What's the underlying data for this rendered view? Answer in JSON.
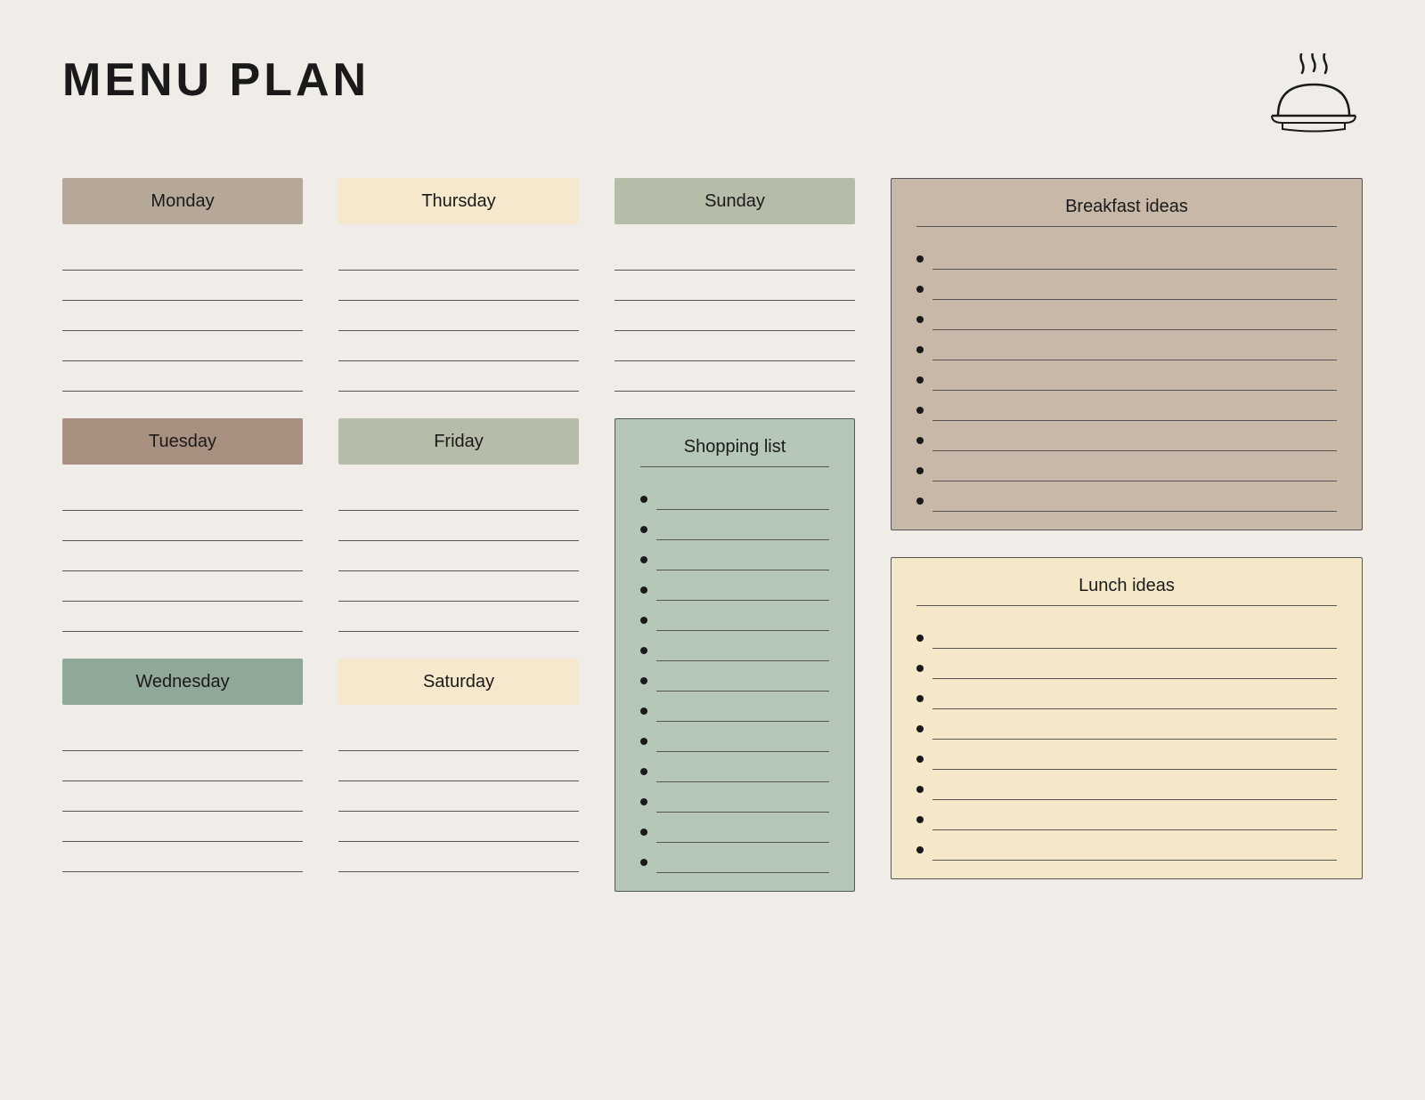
{
  "title": "MENU PLAN",
  "days": {
    "monday": {
      "label": "Monday",
      "color_class": "monday-bg",
      "lines": 5
    },
    "tuesday": {
      "label": "Tuesday",
      "color_class": "tuesday-bg",
      "lines": 5
    },
    "wednesday": {
      "label": "Wednesday",
      "color_class": "wednesday-bg",
      "lines": 5
    },
    "thursday": {
      "label": "Thursday",
      "color_class": "thursday-bg",
      "lines": 5
    },
    "friday": {
      "label": "Friday",
      "color_class": "friday-bg",
      "lines": 5
    },
    "saturday": {
      "label": "Saturday",
      "color_class": "saturday-bg",
      "lines": 5
    },
    "sunday": {
      "label": "Sunday",
      "color_class": "sunday-bg",
      "lines": 5
    }
  },
  "shopping_list": {
    "title": "Shopping list",
    "items": 13
  },
  "breakfast_ideas": {
    "title": "Breakfast ideas",
    "items": 9
  },
  "lunch_ideas": {
    "title": "Lunch ideas",
    "items": 8
  }
}
